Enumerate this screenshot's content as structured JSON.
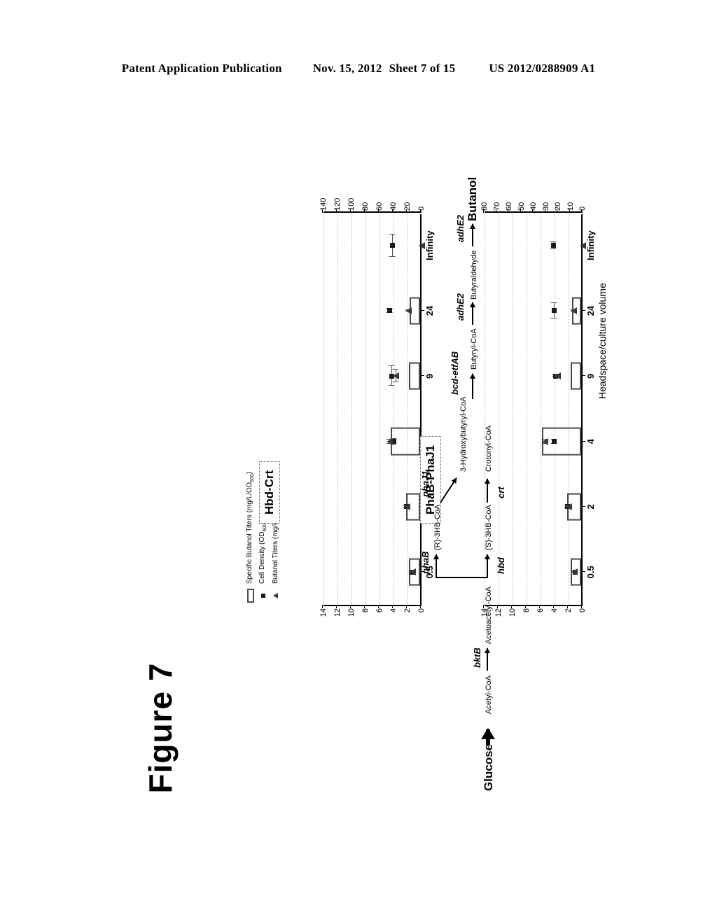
{
  "header": {
    "publication": "Patent Application Publication",
    "date": "Nov. 15, 2012",
    "sheet": "Sheet 7 of 15",
    "number": "US 2012/0288909 A1"
  },
  "figure": {
    "caption": "Figure 7",
    "axis_title": "Headspace/culture volume",
    "categories": [
      "0.5",
      "2",
      "4",
      "9",
      "24",
      "Infinity"
    ],
    "panels": [
      {
        "title": "Hbd-Crt"
      },
      {
        "title": "PhaB-PhaJ1"
      }
    ],
    "legend": [
      {
        "symbol": "open-rectangle",
        "label": "Specific Butanol Titers (mg/L/OD600)"
      },
      {
        "symbol": "filled-square",
        "label": "Cell Density (OD600)"
      },
      {
        "symbol": "filled-triangle",
        "label": "Butanol Titers (mg/L)"
      }
    ],
    "left_axis_ticks": [
      "0",
      "2",
      "4",
      "6",
      "8",
      "10",
      "12",
      "14"
    ],
    "right_axis_ticks_top": [
      "0",
      "20",
      "40",
      "60",
      "80",
      "100",
      "120",
      "140"
    ],
    "right_axis_ticks_bottom": [
      "0",
      "10",
      "20",
      "30",
      "40",
      "50",
      "60",
      "70",
      "80"
    ]
  },
  "chart_data": {
    "type": "bar",
    "title": "Figure 7",
    "xlabel": "Headspace/culture volume",
    "categories": [
      "0.5",
      "2",
      "4",
      "9",
      "24",
      "Infinity"
    ],
    "panels": [
      {
        "name": "Hbd-Crt",
        "ylabel_left": "Specific Butanol Titers (mg/L/OD600)",
        "ylim_left": [
          0,
          14
        ],
        "ylabel_right": "Butanol Titers (mg/L) / Cell Density (OD600)",
        "ylim_right": [
          0,
          140
        ],
        "series": [
          {
            "name": "Specific Butanol Titers (mg/L/OD600)",
            "symbol": "open-rectangle",
            "axis": "left",
            "values": [
              1.6,
              2.0,
              4.2,
              1.6,
              1.5,
              0.0
            ]
          },
          {
            "name": "Cell Density (OD600)",
            "symbol": "filled-square",
            "axis": "right",
            "values": [
              1.4,
              2.2,
              4.0,
              4.3,
              4.6,
              4.2
            ],
            "errors": [
              0.2,
              0.2,
              0.4,
              1.4,
              0.3,
              1.6
            ]
          },
          {
            "name": "Butanol Titers (mg/L)",
            "symbol": "filled-triangle",
            "axis": "right",
            "values": [
              1.3,
              2.1,
              4.6,
              3.7,
              1.9,
              0.0
            ],
            "errors": [
              0.1,
              0.1,
              0.3,
              0.9,
              0.1,
              0.0
            ]
          }
        ]
      },
      {
        "name": "PhaB-PhaJ1",
        "ylabel_left": "Specific Butanol Titers (mg/L/OD600)",
        "ylim_left": [
          0,
          14
        ],
        "ylabel_right": "Butanol Titers (mg/L) / Cell Density (OD600)",
        "ylim_right": [
          0,
          80
        ],
        "series": [
          {
            "name": "Specific Butanol Titers (mg/L/OD600)",
            "symbol": "open-rectangle",
            "axis": "left",
            "values": [
              1.5,
              2.0,
              5.6,
              1.5,
              1.3,
              0.0
            ]
          },
          {
            "name": "Cell Density (OD600)",
            "symbol": "filled-square",
            "axis": "right",
            "values": [
              1.1,
              2.2,
              4.1,
              3.9,
              4.1,
              4.2
            ],
            "errors": [
              0.1,
              0.2,
              0.3,
              0.1,
              1.1,
              0.5
            ]
          },
          {
            "name": "Butanol Titers (mg/L)",
            "symbol": "filled-triangle",
            "axis": "right",
            "values": [
              1.2,
              2.0,
              5.4,
              3.6,
              1.3,
              0.0
            ],
            "errors": [
              0.1,
              0.1,
              0.3,
              0.1,
              0.1,
              0.0
            ]
          }
        ]
      }
    ]
  },
  "pathway": {
    "nodes": [
      {
        "id": "glucose",
        "label": "Glucose"
      },
      {
        "id": "acetyl",
        "label": "Acetyl-CoA"
      },
      {
        "id": "acetoacetyl",
        "label": "Acetoacetyl-CoA"
      },
      {
        "id": "r3hb",
        "label": "(R)-3HB-CoA"
      },
      {
        "id": "s3hb",
        "label": "(S)-3HB-CoA"
      },
      {
        "id": "hydroxy",
        "label": "3-Hydroxybutyryl-CoA"
      },
      {
        "id": "crotonyl",
        "label": "Crotonyl-CoA"
      },
      {
        "id": "butyryl",
        "label": "Butyryl-CoA"
      },
      {
        "id": "butyraldehyde",
        "label": "Butyraldehyde"
      },
      {
        "id": "butanol",
        "label": "Butanol"
      }
    ],
    "genes": [
      "bktB",
      "phaB",
      "hbd",
      "phaJ1",
      "crt",
      "bcd-etfAB",
      "adhE2",
      "adhE2"
    ]
  }
}
